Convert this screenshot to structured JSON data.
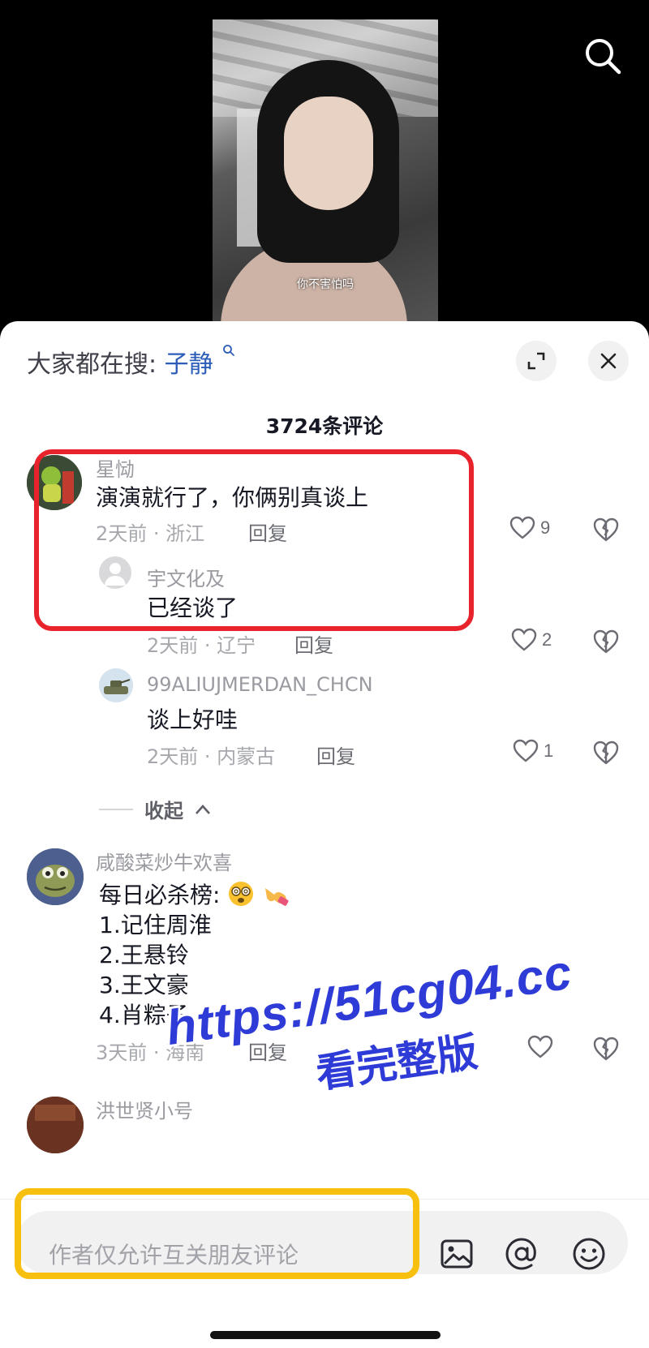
{
  "video": {
    "caption": "你不害怕吗"
  },
  "header": {
    "trending_prefix": "大家都在搜:",
    "trending_keyword": "子静",
    "comment_count": "3724条评论"
  },
  "comments": [
    {
      "nickname": "星恸",
      "text": "演演就行了，你俩别真谈上",
      "meta": "2天前 · 浙江",
      "reply_label": "回复",
      "likes": "9",
      "replies": [
        {
          "nickname": "宇文化及",
          "text": "已经谈了",
          "meta": "2天前 · 辽宁",
          "reply_label": "回复",
          "likes": "2"
        },
        {
          "nickname": "99ALIUJMERDAN_CHCN",
          "text": "谈上好哇",
          "meta": "2天前 · 内蒙古",
          "reply_label": "回复",
          "likes": "1"
        }
      ],
      "collapse_label": "收起"
    },
    {
      "nickname": "咸酸菜炒牛欢喜",
      "lines": [
        "每日必杀榜:",
        "1.记住周淮",
        "2.王悬铃",
        "3.王文豪",
        "4.肖粽子"
      ],
      "meta": "3天前 · 海南",
      "reply_label": "回复",
      "likes": ""
    },
    {
      "nickname": "洪世贤小号"
    }
  ],
  "watermark": {
    "url": "https://51cg04.cc",
    "text": "看完整版"
  },
  "input": {
    "placeholder": "作者仅允许互关朋友评论"
  },
  "colors": {
    "accent_link": "#2b5cb8",
    "highlight_red": "#e8232c",
    "highlight_yellow": "#f7bf0e",
    "watermark_blue": "#2e3bd6"
  },
  "icons": [
    "search-icon",
    "expand-icon",
    "close-icon",
    "heart-icon",
    "broken-heart-icon",
    "chevron-up-icon",
    "image-icon",
    "at-icon",
    "emoji-icon"
  ]
}
